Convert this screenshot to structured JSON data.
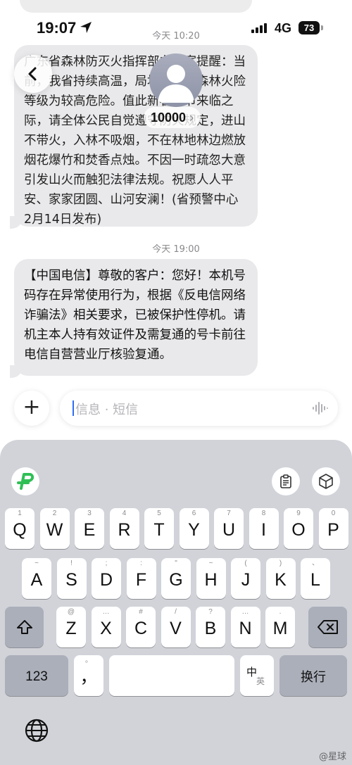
{
  "status_bar": {
    "time": "19:07",
    "network": "4G",
    "battery": "73"
  },
  "conversation": {
    "contact": "10000",
    "contact_chevron": "›",
    "messages": [
      {
        "timestamp": "今天 10:20",
        "text": "广东省森林防灭火指挥部办公室提醒：当前，我省持续高温，局地分时段森林火险等级为较高危险。值此新春佳节来临之际，请全体公民自觉遵守防火规定，进山不带火，入林不吸烟，不在林地林边燃放烟花爆竹和焚香点烛。不因一时疏忽大意引发山火而触犯法律法规。祝愿人人平安、家家团圆、山河安澜！(省预警中心 2月14日发布)"
      },
      {
        "timestamp": "今天 19:00",
        "text": "【中国电信】尊敬的客户：您好！本机号码存在异常使用行为，根据《反电信网络诈骗法》相关要求，已被保护性停机。请机主本人持有效证件及需复通的号卡前往电信自营营业厅核验复通。"
      }
    ]
  },
  "composer": {
    "plus": "+",
    "placeholder": "信息 · 短信"
  },
  "keyboard": {
    "row1": [
      {
        "k": "Q",
        "s": "1"
      },
      {
        "k": "W",
        "s": "2"
      },
      {
        "k": "E",
        "s": "3"
      },
      {
        "k": "R",
        "s": "4"
      },
      {
        "k": "T",
        "s": "5"
      },
      {
        "k": "Y",
        "s": "6"
      },
      {
        "k": "U",
        "s": "7"
      },
      {
        "k": "I",
        "s": "8"
      },
      {
        "k": "O",
        "s": "9"
      },
      {
        "k": "P",
        "s": "0"
      }
    ],
    "row2": [
      {
        "k": "A",
        "s": "~"
      },
      {
        "k": "S",
        "s": "!"
      },
      {
        "k": "D",
        "s": ";"
      },
      {
        "k": "F",
        "s": ":"
      },
      {
        "k": "G",
        "s": "\""
      },
      {
        "k": "H",
        "s": "~"
      },
      {
        "k": "J",
        "s": "("
      },
      {
        "k": "K",
        "s": ")"
      },
      {
        "k": "L",
        "s": "、"
      }
    ],
    "row3": [
      {
        "k": "Z",
        "s": "@"
      },
      {
        "k": "X",
        "s": "…"
      },
      {
        "k": "C",
        "s": "#"
      },
      {
        "k": "V",
        "s": "/"
      },
      {
        "k": "B",
        "s": "?"
      },
      {
        "k": "N",
        "s": "…"
      },
      {
        "k": "M",
        "s": "."
      }
    ],
    "numbers_key": "123",
    "comma_key": "，",
    "comma_sub": "。",
    "lang_key_top": "中",
    "lang_key_bottom": "英",
    "return_key": "换行"
  },
  "watermark": "@星球"
}
